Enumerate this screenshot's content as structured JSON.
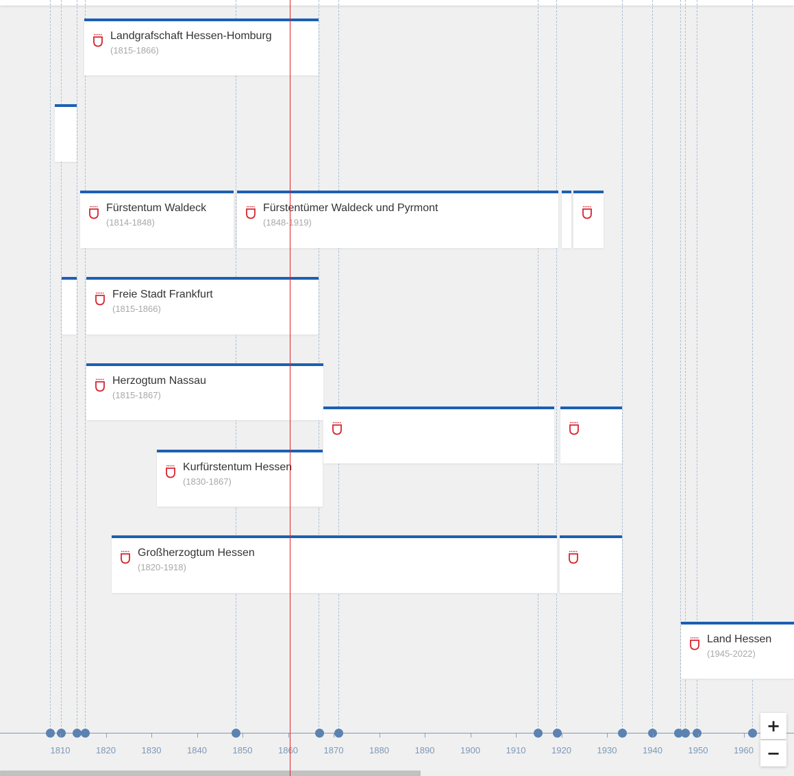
{
  "colors": {
    "accent": "#1a5fb4",
    "marker": "#e0222b",
    "dot": "#5b82b1",
    "background": "#f0f0f0"
  },
  "cards": [
    {
      "title": "Landgrafschaft Hessen-Homburg",
      "years": "(1815-1866)"
    },
    {
      "title": "Fürstentum Waldeck",
      "years": "(1814-1848)"
    },
    {
      "title": "Fürstentümer Waldeck und Pyrmont",
      "years": "(1848-1919)"
    },
    {
      "title": "Freie Stadt Frankfurt",
      "years": "(1815-1866)"
    },
    {
      "title": "Herzogtum Nassau",
      "years": "(1815-1867)"
    },
    {
      "title": "Kurfürstentum Hessen",
      "years": "(1830-1867)"
    },
    {
      "title": "Großherzogtum Hessen",
      "years": "(1820-1918)"
    },
    {
      "title": "Land Hessen",
      "years": "(1945-2022)"
    }
  ],
  "axis": {
    "ticks": [
      "1810",
      "1820",
      "1830",
      "1840",
      "1850",
      "1860",
      "1870",
      "1880",
      "1890",
      "1900",
      "1910",
      "1920",
      "1930",
      "1940",
      "1950",
      "1960"
    ]
  },
  "zoom": {
    "in_label": "+",
    "out_label": "−"
  },
  "icons": {
    "card": "coat-of-arms-icon",
    "zoom_in": "plus-icon",
    "zoom_out": "minus-icon"
  }
}
